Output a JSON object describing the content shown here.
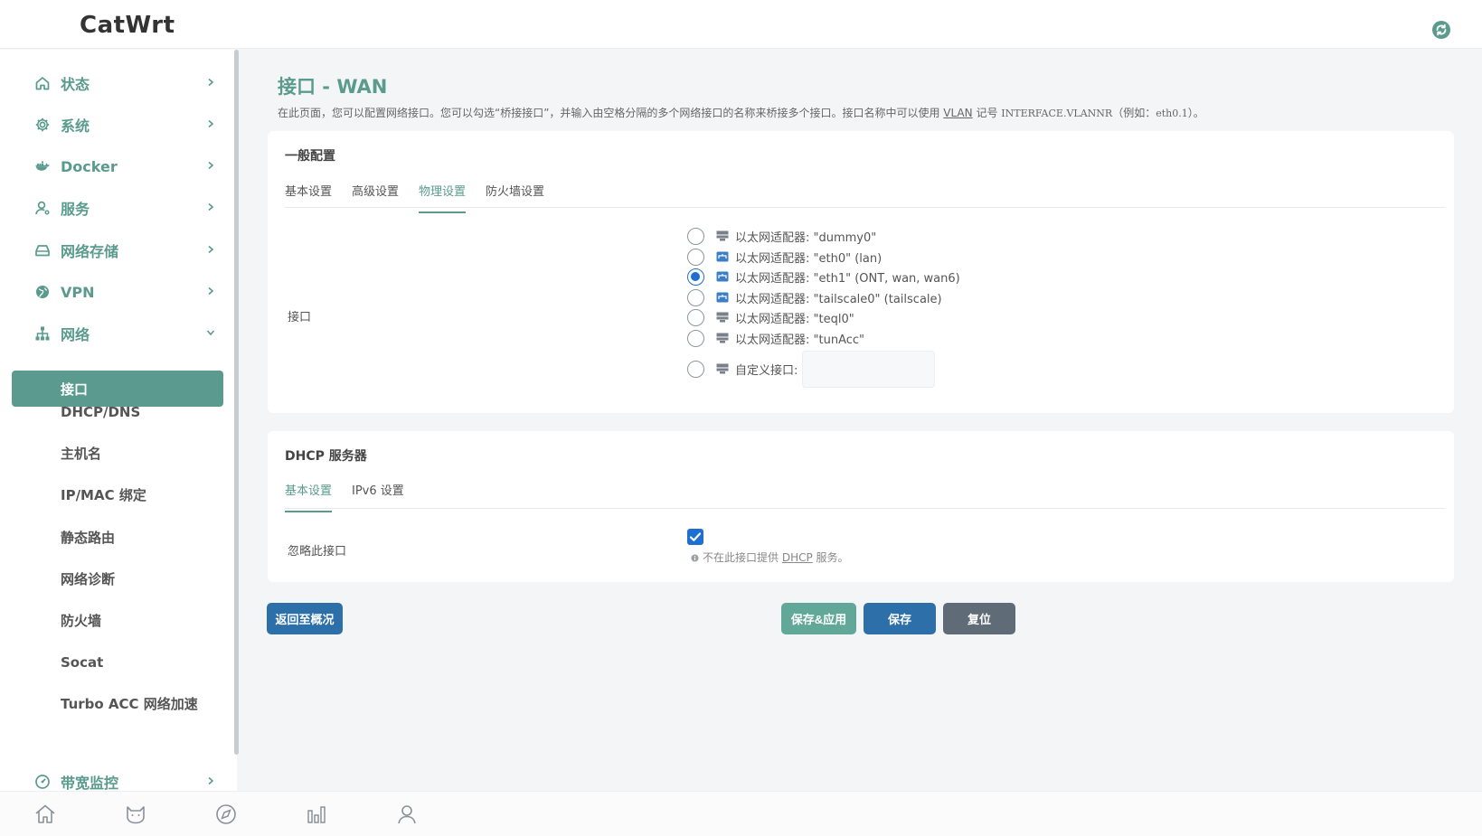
{
  "header": {
    "logo": "CatWrt",
    "refresh_icon": "refresh-icon",
    "accent": "#5a9b8e"
  },
  "sidebar": {
    "top_items": [
      {
        "label": "状态",
        "icon": "home-icon"
      },
      {
        "label": "系统",
        "icon": "gear-icon"
      },
      {
        "label": "Docker",
        "icon": "docker-icon"
      },
      {
        "label": "服务",
        "icon": "user-service-icon"
      },
      {
        "label": "网络存储",
        "icon": "storage-icon"
      },
      {
        "label": "VPN",
        "icon": "globe-icon"
      },
      {
        "label": "网络",
        "icon": "network-icon"
      }
    ],
    "network_subitems": [
      "接口",
      "DHCP/DNS",
      "主机名",
      "IP/MAC 绑定",
      "静态路由",
      "网络诊断",
      "防火墙",
      "Socat",
      "Turbo ACC 网络加速"
    ],
    "active_subitem": "接口",
    "bottom_item": {
      "label": "带宽监控",
      "icon": "gauge-icon"
    }
  },
  "bottom_nav": [
    "home-icon",
    "cat-icon",
    "compass-icon",
    "bar-chart-icon",
    "user-icon"
  ],
  "page": {
    "title": "接口 - WAN",
    "desc_prefix": "在此页面，您可以配置网络接口。您可以勾选“桥接接口”，并输入由空格分隔的多个网络接口的名称来桥接多个接口。接口名称中可以使用 ",
    "desc_link": "VLAN",
    "desc_mid": " 记号 ",
    "desc_code": "INTERFACE.VLANNR",
    "desc_mid2": "（例如：",
    "desc_example": "eth0.1",
    "desc_suffix": "）。"
  },
  "general": {
    "title": "一般配置",
    "tabs": [
      "基本设置",
      "高级设置",
      "物理设置",
      "防火墙设置"
    ],
    "active_tab": "物理设置",
    "interface_label": "接口",
    "adapters": [
      {
        "label": "以太网适配器: \"dummy0\"",
        "icon": "ethernet-port-icon",
        "checked": false
      },
      {
        "label": "以太网适配器: \"eth0\" (lan)",
        "icon": "network-bridge-icon",
        "checked": false
      },
      {
        "label": "以太网适配器: \"eth1\" (ONT, wan, wan6)",
        "icon": "network-bridge-icon",
        "checked": true
      },
      {
        "label": "以太网适配器: \"tailscale0\" (tailscale)",
        "icon": "network-bridge-icon",
        "checked": false
      },
      {
        "label": "以太网适配器: \"teql0\"",
        "icon": "ethernet-port-icon",
        "checked": false
      },
      {
        "label": "以太网适配器: \"tunAcc\"",
        "icon": "ethernet-port-icon",
        "checked": false
      }
    ],
    "custom_label": "自定义接口:",
    "custom_value": ""
  },
  "dhcp": {
    "title": "DHCP 服务器",
    "tabs": [
      "基本设置",
      "IPv6 设置"
    ],
    "active_tab": "基本设置",
    "ignore_label": "忽略此接口",
    "ignore_checked": true,
    "hint_prefix": "不在此接口提供 ",
    "hint_link": "DHCP",
    "hint_suffix": " 服务。"
  },
  "buttons": {
    "back": "返回至概况",
    "save_apply": "保存&应用",
    "save": "保存",
    "reset": "复位"
  }
}
